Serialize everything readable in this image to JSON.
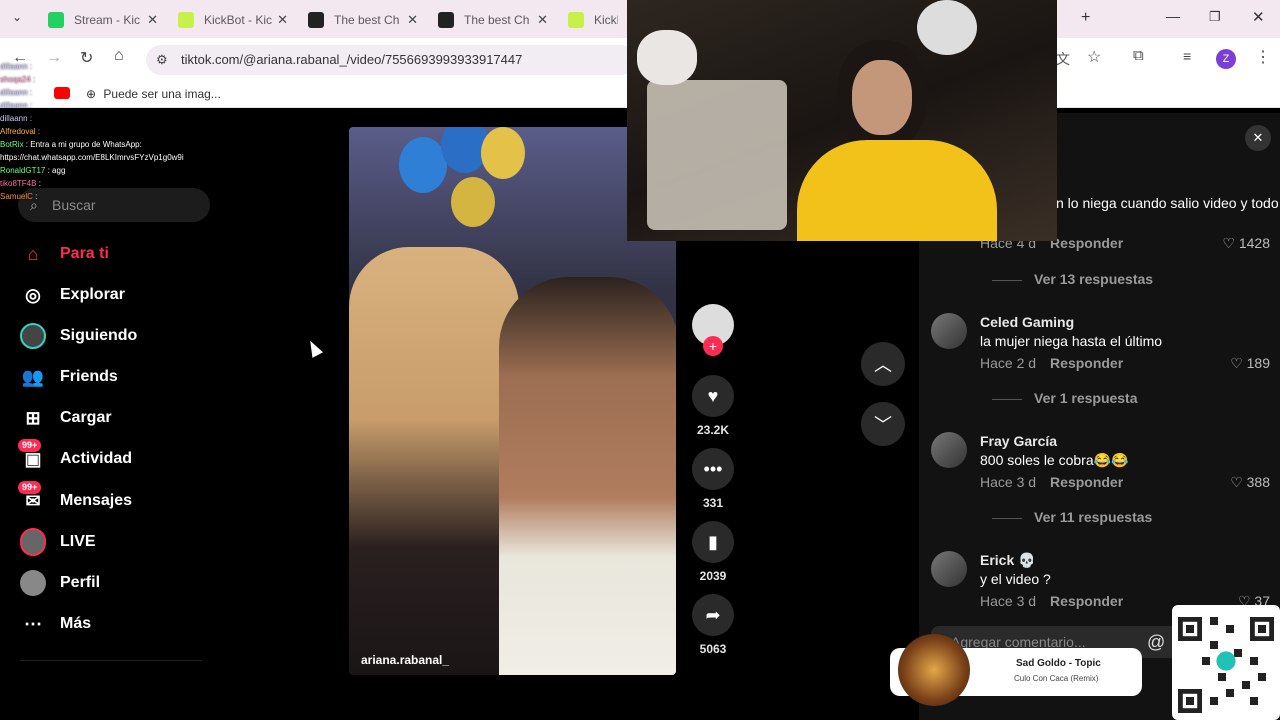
{
  "tabs": [
    {
      "label": "Stream - Kic",
      "color": "#23d160"
    },
    {
      "label": "KickBot - Kic",
      "color": "#c8f04a"
    },
    {
      "label": "The best Ch",
      "color": "#222222"
    },
    {
      "label": "The best Ch",
      "color": "#222222"
    },
    {
      "label": "KickBot",
      "color": "#c8f04a"
    }
  ],
  "address": {
    "url": "tiktok.com/@ariana.rabanal_/video/7556693993933917447"
  },
  "bookmarks": {
    "item": "Puede ser una imag..."
  },
  "chat": [
    {
      "user": "dillaann",
      "msg": ":"
    },
    {
      "user": "shoqa24",
      "msg": ":"
    },
    {
      "user": "dillaann",
      "msg": ":"
    },
    {
      "user": "dillaann",
      "msg": ":"
    },
    {
      "user": "dillaann",
      "msg": ":"
    },
    {
      "user": "Alfredoval",
      "msg": ":"
    },
    {
      "user": "BotRix",
      "msg": ": Entra a mi grupo de WhatsApp:"
    },
    {
      "user": "",
      "msg": "https://chat.whatsapp.com/E8LKImrvsFYzVp1g0w9i"
    },
    {
      "user": "RonaldGT17",
      "msg": ": agg"
    },
    {
      "user": "tiko8TF4B",
      "msg": ":"
    },
    {
      "user": "SamuelC",
      "msg": ":"
    }
  ],
  "sidebar": {
    "search_placeholder": "Buscar",
    "items": [
      {
        "label": "Para ti",
        "icon": "home-icon",
        "active": true
      },
      {
        "label": "Explorar",
        "icon": "compass-icon"
      },
      {
        "label": "Siguiendo",
        "icon": "following-avatar-icon"
      },
      {
        "label": "Friends",
        "icon": "friends-icon"
      },
      {
        "label": "Cargar",
        "icon": "upload-icon"
      },
      {
        "label": "Actividad",
        "icon": "inbox-icon",
        "badge": "99+"
      },
      {
        "label": "Mensajes",
        "icon": "message-icon",
        "badge": "99+"
      },
      {
        "label": "LIVE",
        "icon": "live-avatar-icon"
      },
      {
        "label": "Perfil",
        "icon": "profile-avatar-icon"
      },
      {
        "label": "Más",
        "icon": "more-icon"
      }
    ]
  },
  "video": {
    "handle": "ariana.rabanal_"
  },
  "actions": {
    "likes": "23.2K",
    "comments": "331",
    "saves": "2039",
    "shares": "5063"
  },
  "comments": {
    "partial_text": "n lo niega cuando salio video y todo",
    "items": [
      {
        "name": "",
        "text": "",
        "time": "Hace 4 d",
        "reply": "Responder",
        "likes": "1428",
        "replies": "Ver 13 respuestas"
      },
      {
        "name": "Celed Gaming",
        "text": "la mujer niega hasta el último",
        "time": "Hace 2 d",
        "reply": "Responder",
        "likes": "189",
        "replies": "Ver 1 respuesta"
      },
      {
        "name": "Fray García",
        "text": "800 soles le cobra😂😂",
        "time": "Hace 3 d",
        "reply": "Responder",
        "likes": "388",
        "replies": "Ver 11 respuestas"
      },
      {
        "name": "Erick 💀",
        "text": "y el video ?",
        "time": "Hace 3 d",
        "reply": "Responder",
        "likes": "37",
        "replies": ""
      }
    ],
    "input_placeholder": "Agregar comentario..."
  },
  "now_playing": {
    "title": "Sad Goldo - Topic",
    "subtitle": "Culo Con Caca (Remix)"
  },
  "colors": {
    "accent": "#fe2c55",
    "panel": "#121212"
  }
}
